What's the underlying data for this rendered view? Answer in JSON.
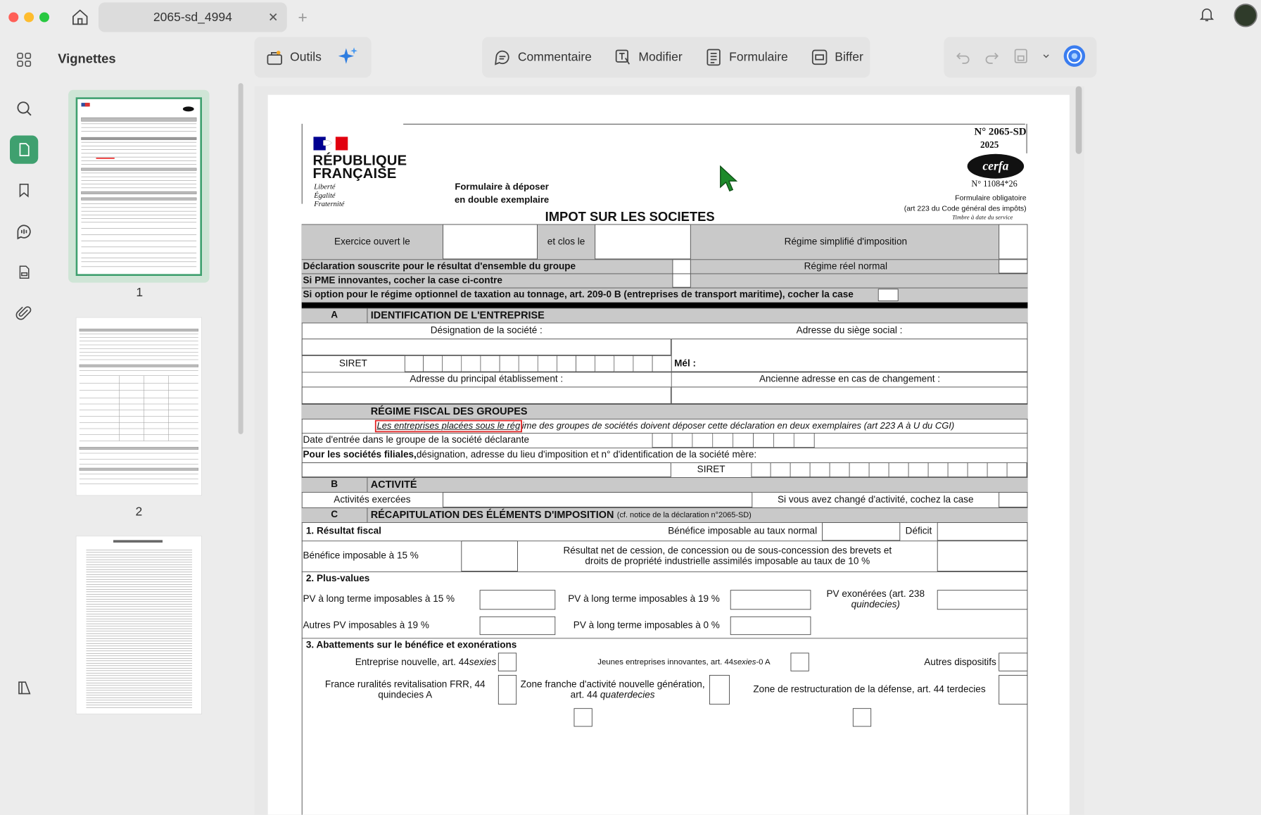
{
  "app": {
    "tab_title": "2065-sd_4994",
    "thumbs_title": "Vignettes"
  },
  "toolbar": {
    "outils": "Outils",
    "commentaire": "Commentaire",
    "modifier": "Modifier",
    "formulaire": "Formulaire",
    "biffer": "Biffer"
  },
  "thumbs": [
    {
      "num": "1"
    },
    {
      "num": "2"
    }
  ],
  "colors": {
    "accent": "#3fa06f",
    "red": "#ff5f57",
    "yellow": "#febc2e",
    "green": "#28c840"
  },
  "form": {
    "rf1": "RÉPUBLIQUE",
    "rf2": "FRANÇAISE",
    "devise1": "Liberté",
    "devise2": "Égalité",
    "devise3": "Fraternité",
    "depot1": "Formulaire à déposer",
    "depot2": "en double exemplaire",
    "num": "N° 2065-SD",
    "year": "2025",
    "cerfa": "cerfa",
    "cerfa_num": "N° 11084*26",
    "oblig": "Formulaire obligatoire",
    "art": "(art 223 du Code général des impôts)",
    "timbre": "Timbre à date du service",
    "title": "IMPOT SUR LES SOCIETES",
    "ex_ouvert": "Exercice ouvert le",
    "clos": "et clos le",
    "reg_simpl": "Régime simplifié d'imposition",
    "decl": "Déclaration souscrite pour le résultat d'ensemble du groupe",
    "reg_reel": "Régime réel normal",
    "pme": "Si PME innovantes, cocher la case ci-contre",
    "tonnage": "Si option pour le régime optionnel de taxation au tonnage, art. 209-0 B (entreprises de transport maritime), cocher la case",
    "sec_a": "A",
    "sec_a_t": "IDENTIFICATION DE L'ENTREPRISE",
    "design": "Désignation de la société :",
    "adresse": "Adresse du siège social :",
    "siret": "SIRET",
    "mel": "Mél :",
    "princ": "Adresse du principal établissement :",
    "anc": "Ancienne adresse en cas de changement :",
    "regime_groupes": "RÉGIME FISCAL DES GROUPES",
    "grp_hl": "Les entreprises placées sous le rég",
    "grp_rest": "ime des groupes de sociétés doivent déposer cette déclaration en deux exemplaires (art 223 A à U du CGI)",
    "date_entree": "Date d'entrée dans le groupe de la société déclarante",
    "filiales_b": "Pour les sociétés filiales,",
    "filiales": " désignation, adresse du lieu d'imposition et n° d'identification de la société mère:",
    "siret2": "SIRET",
    "sec_b": "B",
    "sec_b_t": "ACTIVITÉ",
    "activites": "Activités exercées",
    "chg_act": "Si vous avez changé d'activité, cochez la case",
    "sec_c": "C",
    "sec_c_t": "RÉCAPITULATION DES ÉLÉMENTS D'IMPOSITION",
    "sec_c_note": "(cf. notice de la déclaration n°2065-SD)",
    "r1": "1. Résultat fiscal",
    "benef_normal": "Bénéfice imposable au taux normal",
    "deficit": "Déficit",
    "benef15": "Bénéfice imposable à 15 %",
    "cession1": "Résultat net de cession, de concession ou de sous-concession des brevets et",
    "cession2": "droits de propriété industrielle assimilés imposable au taux de 10 %",
    "pv": "2. Plus-values",
    "pv15": "PV à long terme imposables à 15 %",
    "pv19": "PV à long terme imposables à 19 %",
    "pvexo1": "PV exonérées (art. 238",
    "pvexo2": "quindecies)",
    "autres19": "Autres PV imposables à 19 %",
    "pv0": "PV à long terme imposables à 0 %",
    "abat": "3. Abattements sur le bénéfice et exonérations",
    "nouvelle": "Entreprise nouvelle, art. 44 ",
    "nouvelle_i": "sexies",
    "jei": "Jeunes entreprises innovantes, art. 44 ",
    "jei_i": "sexies",
    "jei_s": "-0 A",
    "autres_disp": "Autres dispositifs",
    "frr1": "France ruralités revitalisation FRR, 44",
    "frr2": "quindecies A",
    "zfang1": "Zone franche d'activité nouvelle génération,",
    "zfang2": "art. 44 ",
    "zfang2_i": "quaterdecies",
    "zrd": "Zone de restructuration de la défense, art. 44 terdecies"
  }
}
